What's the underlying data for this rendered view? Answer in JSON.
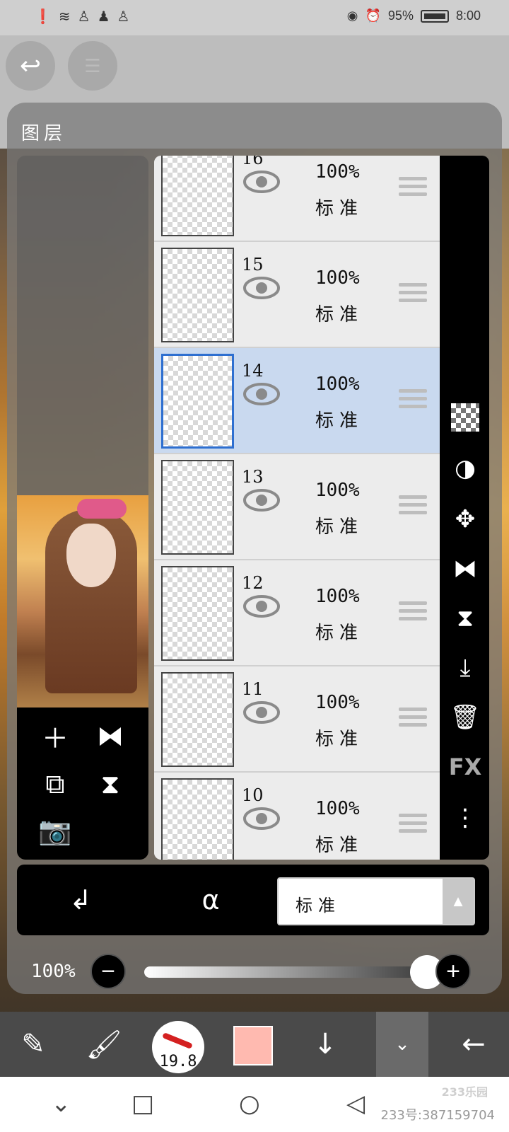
{
  "status_bar": {
    "left_icons": [
      "alert-icon",
      "wifi-icon",
      "notification-icon",
      "qq-icon",
      "notification-icon"
    ],
    "battery": "95%",
    "time": "8:00"
  },
  "header": {
    "back_icon": "undo-icon",
    "menu_icon": "menu-icon"
  },
  "panel": {
    "title": "图层"
  },
  "layers": [
    {
      "number": "16",
      "opacity": "100%",
      "blend": "标准",
      "selected": false
    },
    {
      "number": "15",
      "opacity": "100%",
      "blend": "标准",
      "selected": false
    },
    {
      "number": "14",
      "opacity": "100%",
      "blend": "标准",
      "selected": true
    },
    {
      "number": "13",
      "opacity": "100%",
      "blend": "标准",
      "selected": false
    },
    {
      "number": "12",
      "opacity": "100%",
      "blend": "标准",
      "selected": false
    },
    {
      "number": "11",
      "opacity": "100%",
      "blend": "标准",
      "selected": false
    },
    {
      "number": "10",
      "opacity": "100%",
      "blend": "标准",
      "selected": false
    }
  ],
  "right_tools": {
    "fx_label": "FX"
  },
  "bottom": {
    "blend_mode": "标准",
    "opacity_label": "100%",
    "opacity_value": 1.0
  },
  "toolbar": {
    "brush_size": "19.8",
    "color": "#ffbab0"
  },
  "watermark": {
    "logo": "233乐园",
    "id_text": "233号:387159704"
  },
  "colors": {
    "selected_row": "#c9d9ef",
    "selected_border": "#2e6fd0",
    "panel_bg": "#787878"
  }
}
